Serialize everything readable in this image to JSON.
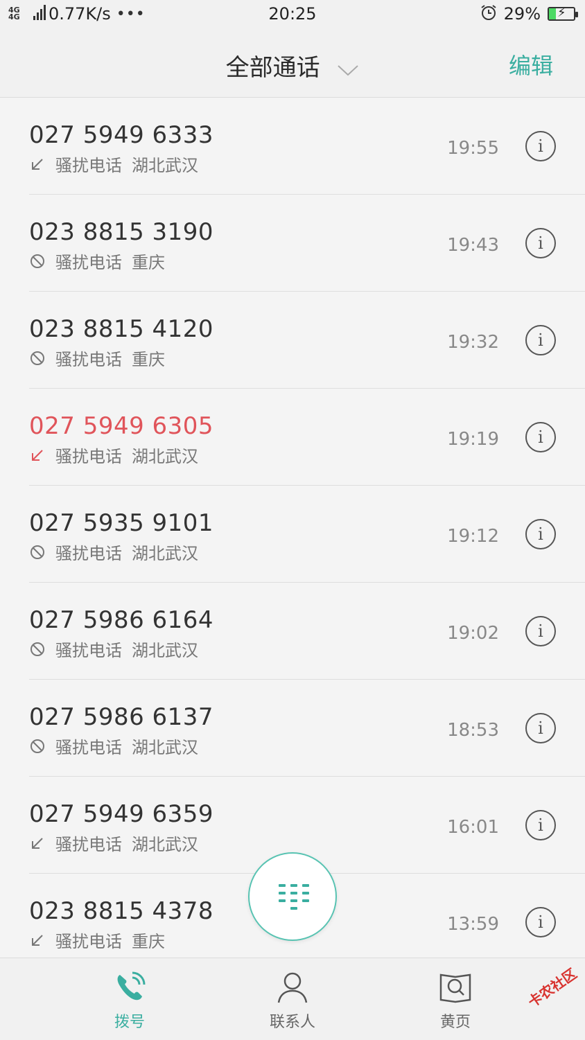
{
  "status_bar": {
    "network": "4G 4G",
    "speed": "0.77K/s",
    "dots": "•••",
    "time": "20:25",
    "battery_pct": "29%",
    "battery_level": 0.29
  },
  "header": {
    "title": "全部通话",
    "edit_label": "编辑"
  },
  "colors": {
    "accent": "#3aaea0",
    "missed": "#e0545a"
  },
  "calls": [
    {
      "number": "027 5949 6333",
      "type": "incoming",
      "tag": "骚扰电话",
      "location": "湖北武汉",
      "time": "19:55"
    },
    {
      "number": "023 8815 3190",
      "type": "blocked",
      "tag": "骚扰电话",
      "location": "重庆",
      "time": "19:43"
    },
    {
      "number": "023 8815 4120",
      "type": "blocked",
      "tag": "骚扰电话",
      "location": "重庆",
      "time": "19:32"
    },
    {
      "number": "027 5949 6305",
      "type": "missed",
      "tag": "骚扰电话",
      "location": "湖北武汉",
      "time": "19:19"
    },
    {
      "number": "027 5935 9101",
      "type": "blocked",
      "tag": "骚扰电话",
      "location": "湖北武汉",
      "time": "19:12"
    },
    {
      "number": "027 5986 6164",
      "type": "blocked",
      "tag": "骚扰电话",
      "location": "湖北武汉",
      "time": "19:02"
    },
    {
      "number": "027 5986 6137",
      "type": "blocked",
      "tag": "骚扰电话",
      "location": "湖北武汉",
      "time": "18:53"
    },
    {
      "number": "027 5949 6359",
      "type": "incoming",
      "tag": "骚扰电话",
      "location": "湖北武汉",
      "time": "16:01"
    },
    {
      "number": "023 8815 4378",
      "type": "incoming",
      "tag": "骚扰电话",
      "location": "重庆",
      "time": "13:59"
    }
  ],
  "bottom_nav": [
    {
      "label": "拨号",
      "icon": "phone-icon",
      "active": true
    },
    {
      "label": "联系人",
      "icon": "person-icon",
      "active": false
    },
    {
      "label": "黄页",
      "icon": "yellow-pages-icon",
      "active": false
    }
  ],
  "watermark": "卡农社区"
}
